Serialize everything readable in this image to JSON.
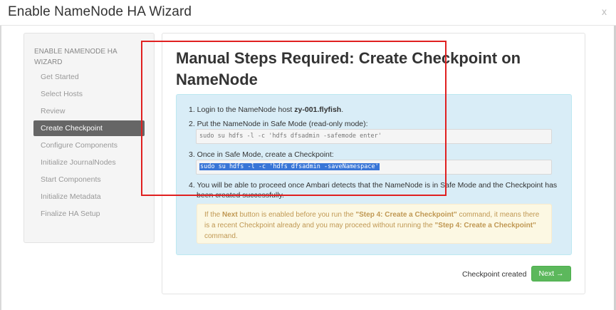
{
  "modal": {
    "title": "Enable NameNode HA Wizard",
    "close": "x"
  },
  "sidebar": {
    "header": "ENABLE NAMENODE HA WIZARD",
    "items": [
      {
        "label": "Get Started"
      },
      {
        "label": "Select Hosts"
      },
      {
        "label": "Review"
      },
      {
        "label": "Create Checkpoint",
        "active": true
      },
      {
        "label": "Configure Components"
      },
      {
        "label": "Initialize JournalNodes"
      },
      {
        "label": "Start Components"
      },
      {
        "label": "Initialize Metadata"
      },
      {
        "label": "Finalize HA Setup"
      }
    ]
  },
  "main": {
    "title": "Manual Steps Required: Create Checkpoint on NameNode",
    "steps": {
      "s1_prefix": "1. Login to the NameNode host ",
      "s1_host": "zy-001.flyfish",
      "s1_suffix": ".",
      "s2": "2. Put the NameNode in Safe Mode (read-only mode):",
      "cmd1": "sudo su hdfs -l -c 'hdfs dfsadmin -safemode enter'",
      "s3": "3. Once in Safe Mode, create a Checkpoint:",
      "cmd2": "sudo su hdfs -l -c 'hdfs dfsadmin -saveNamespace'",
      "s4_line1": "4. You will be able to proceed once Ambari detects that the NameNode is in Safe Mode and the Checkpoint has",
      "s4_line2": "been created successfully."
    },
    "warning": {
      "p1": "If the ",
      "b1": "Next",
      "p2": " button is enabled before you run the ",
      "b2": "\"Step 4: Create a Checkpoint\"",
      "p3": " command, it means there is a recent Checkpoint already and you may proceed without running the ",
      "b3": "\"Step 4: Create a Checkpoint\"",
      "p4": " command."
    },
    "status": "Checkpoint created",
    "next_label": "Next →"
  },
  "colors": {
    "accent_green": "#5cb85c",
    "info_bg": "#d9edf7",
    "warning_bg": "#fcf8e3",
    "highlight_red": "#e02020"
  }
}
